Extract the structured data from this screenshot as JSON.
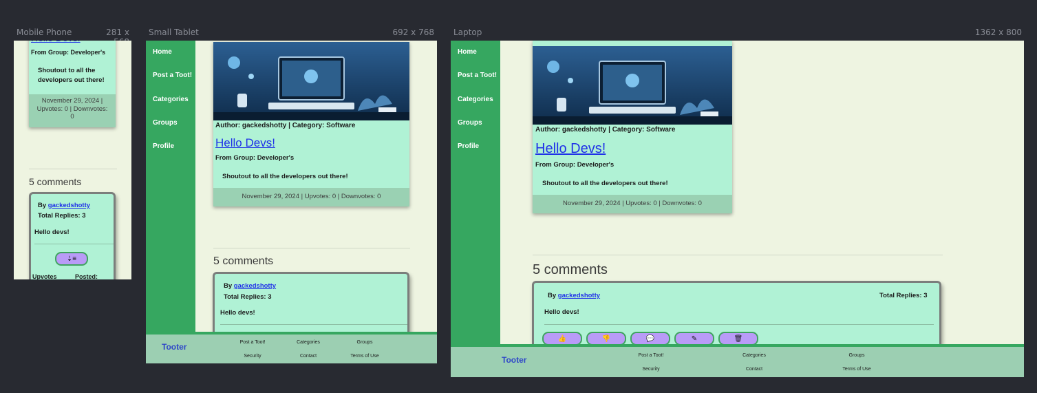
{
  "devices": {
    "mobile": {
      "name": "Mobile Phone",
      "size": "281 x 568"
    },
    "tablet": {
      "name": "Small Tablet",
      "size": "692 x 768"
    },
    "laptop": {
      "name": "Laptop",
      "size": "1362 x 800"
    }
  },
  "nav": {
    "items": [
      "Home",
      "Post a Toot!",
      "Categories",
      "Groups",
      "Profile"
    ]
  },
  "post": {
    "meta": "Author: gackedshotty | Category: Software",
    "title": "Hello Devs!",
    "group": "From Group: Developer's",
    "body": "Shoutout to all the developers out there!",
    "footer": "November 29, 2024 | Upvotes: 0 | Downvotes: 0",
    "mobile_footer_1": "November 29, 2024 |",
    "mobile_footer_2": "Upvotes: 0 | Downvotes:",
    "mobile_footer_3": "0",
    "mobile_body_1": "Shoutout to all the",
    "mobile_body_2": "developers out there!"
  },
  "comments": {
    "heading": "5 comments",
    "by_prefix": "By",
    "author": "gackedshotty",
    "replies": "Total Replies: 3",
    "text": "Hello devs!",
    "mobile_bottom_left": "Upvotes",
    "mobile_bottom_right": "Posted:"
  },
  "footer": {
    "brand": "Tooter",
    "links": [
      "Post a Toot!",
      "Categories",
      "Groups",
      "Security",
      "Contact",
      "Terms of Use"
    ]
  },
  "icons": [
    "thumbs-up-icon",
    "thumbs-down-icon",
    "reply-icon",
    "edit-icon",
    "trash-icon",
    "sort-icon"
  ],
  "colors": {
    "sidebar": "#36a760",
    "card": "#b0f2d5",
    "page": "#eef4e1",
    "button": "#b99bf7",
    "link": "#2032e8"
  }
}
